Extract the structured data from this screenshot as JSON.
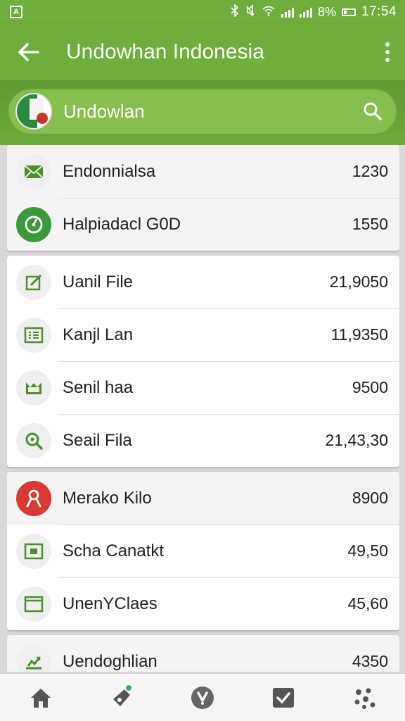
{
  "statusbar": {
    "app_icon_label": "A",
    "battery": "8%",
    "time": "17:54",
    "icons": [
      "bluetooth-icon",
      "mute-icon",
      "wifi-icon",
      "signal-icon",
      "battery-icon"
    ]
  },
  "appbar": {
    "title": "Undowhan Indonesia",
    "back_icon": "arrow-left-icon",
    "menu_icon": "more-vertical-icon"
  },
  "search": {
    "query": "Undowlan",
    "icon": "search-icon"
  },
  "colors": {
    "primary": "#6fae3c",
    "primary_light": "#86bf4e",
    "accent_green": "#3a9a3a",
    "accent_red": "#d63a32",
    "icon_green": "#4b8f2e"
  },
  "list": {
    "groups": [
      [
        {
          "label": "Endonnialsa",
          "value": "1230",
          "icon": "mail-icon"
        },
        {
          "label": "Halpiadacl G0D",
          "value": "1550",
          "icon": "target-icon"
        }
      ],
      [
        {
          "label": "Uanil File",
          "value": "21,9050",
          "icon": "edit-icon"
        },
        {
          "label": "Kanjl Lan",
          "value": "11,9350",
          "icon": "list-icon"
        },
        {
          "label": "Senil haa",
          "value": "9500",
          "icon": "folder-icon"
        },
        {
          "label": "Seail Fila",
          "value": "21,43,30",
          "icon": "search-circle-icon"
        }
      ],
      [
        {
          "label": "Merako Kilo",
          "value": "8900",
          "icon": "person-icon"
        },
        {
          "label": "Scha Canatkt",
          "value": "49,50",
          "icon": "contact-card-icon"
        },
        {
          "label": "UnenYClaes",
          "value": "45,60",
          "icon": "window-icon"
        }
      ],
      [
        {
          "label": "Uendoghlian",
          "value": "4350",
          "icon": "chart-icon"
        }
      ]
    ]
  },
  "bottom_nav": [
    {
      "name": "home-icon"
    },
    {
      "name": "tag-icon"
    },
    {
      "name": "shield-icon"
    },
    {
      "name": "checkbox-icon"
    },
    {
      "name": "apps-icon"
    }
  ]
}
